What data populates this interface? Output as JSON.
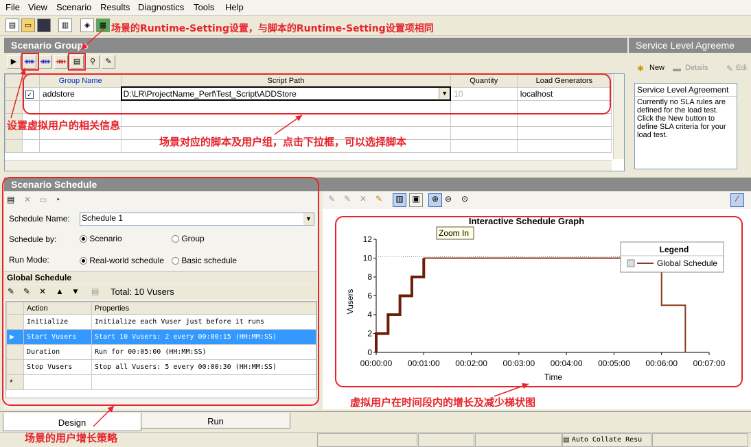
{
  "menu": [
    "File",
    "View",
    "Scenario",
    "Results",
    "Diagnostics",
    "Tools",
    "Help"
  ],
  "groups": {
    "title": "Scenario Groups",
    "columns": [
      "Group Name",
      "Script Path",
      "Quantity",
      "Load Generators"
    ],
    "row": {
      "name": "addstore",
      "path": "D:\\LR\\ProjectName_Perf\\Test_Script\\ADDStore",
      "quantity": "10",
      "generator": "localhost"
    }
  },
  "sla": {
    "title": "Service Level Agreeme",
    "new_label": "New",
    "details_label": "Details",
    "edit_label": "Edi",
    "box_title": "Service Level Agreement",
    "box_text": "Currently no SLA rules are defined for the load test. Click the New button to define SLA criteria for your load test."
  },
  "schedule": {
    "title": "Scenario Schedule",
    "name_label": "Schedule Name:",
    "name_value": "Schedule 1",
    "by_label": "Schedule by:",
    "by_scenario": "Scenario",
    "by_group": "Group",
    "mode_label": "Run Mode:",
    "mode_real": "Real-world schedule",
    "mode_basic": "Basic schedule",
    "global_title": "Global Schedule",
    "total": "Total: 10 Vusers",
    "columns": [
      "Action",
      "Properties"
    ],
    "rows": [
      {
        "action": "Initialize",
        "props": "Initialize each Vuser just before it runs"
      },
      {
        "action": "Start  Vusers",
        "props": "Start 10 Vusers: 2 every 00:00:15 (HH:MM:SS)"
      },
      {
        "action": "Duration",
        "props": "Run for 00:05:00 (HH:MM:SS)"
      },
      {
        "action": "Stop Vusers",
        "props": "Stop all Vusers: 5 every 00:00:30 (HH:MM:SS)"
      }
    ],
    "new_row_marker": "*"
  },
  "tooltip": "Zoom In",
  "chart_data": {
    "type": "line",
    "title": "Interactive Schedule Graph",
    "xlabel": "Time",
    "ylabel": "Vusers",
    "xticks": [
      "00:00:00",
      "00:01:00",
      "00:02:00",
      "00:03:00",
      "00:04:00",
      "00:05:00",
      "00:06:00",
      "00:07:00"
    ],
    "yticks": [
      "0",
      "2",
      "4",
      "6",
      "8",
      "10",
      "12"
    ],
    "ylim": [
      0,
      12
    ],
    "xlim_seconds": [
      0,
      420
    ],
    "legend_title": "Legend",
    "legend_position": "top-right",
    "series": [
      {
        "name": "Global Schedule",
        "color": "#8b3a1a",
        "x_seconds": [
          0,
          0,
          15,
          15,
          30,
          30,
          45,
          45,
          60,
          60,
          360,
          360,
          390,
          390
        ],
        "y": [
          0,
          2,
          2,
          4,
          4,
          6,
          6,
          8,
          8,
          10,
          10,
          5,
          5,
          0
        ]
      }
    ]
  },
  "tabs": [
    "Design",
    "Run"
  ],
  "status": {
    "auto_collate": "Auto Collate Resu"
  },
  "annotations": {
    "runtime": "场景的Runtime-Setting设置，与脚本的Runtime-Setting设置项相同",
    "users": "设置虚拟用户的相关信息",
    "script": "场景对应的脚本及用户组，点击下拉框，可以选择脚本",
    "graph": "虚拟用户在时间段内的增长及减少梯状图",
    "strategy": "场景的用户增长策略"
  },
  "colors": {
    "annotation": "#e8232a",
    "series": "#8b3a1a",
    "selection": "#3399ff",
    "header": "#8a8a8a"
  }
}
